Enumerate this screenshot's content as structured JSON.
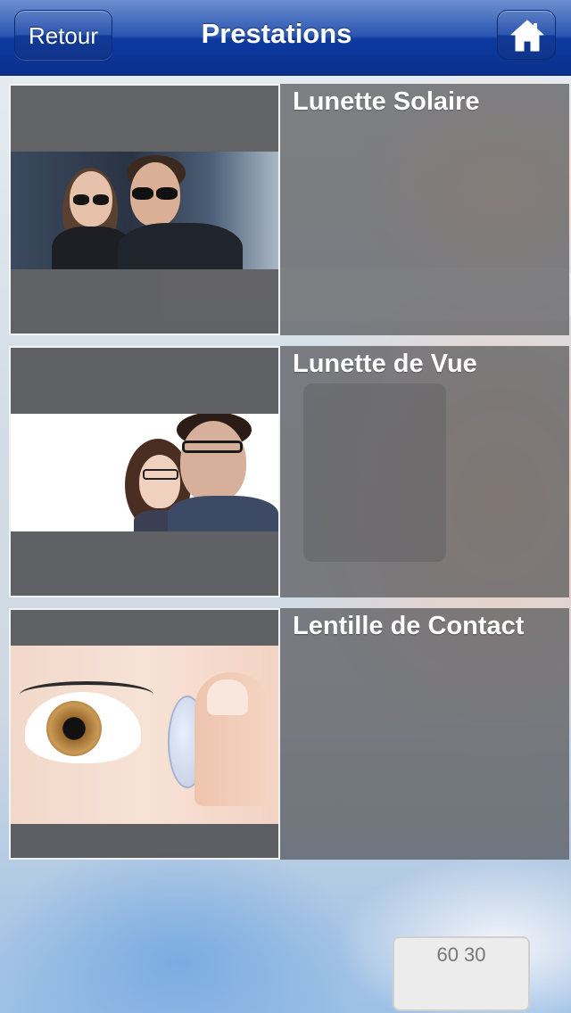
{
  "navbar": {
    "title": "Prestations",
    "back_label": "Retour",
    "home_icon": "home-icon"
  },
  "services": [
    {
      "title": "Lunette Solaire",
      "image": "sunglasses-couple-photo"
    },
    {
      "title": "Lunette de Vue",
      "image": "eyeglasses-couple-photo"
    },
    {
      "title": "Lentille de Contact",
      "image": "contact-lens-photo"
    }
  ],
  "background": {
    "dial_text": "60 30"
  },
  "colors": {
    "navbar": "#0d3aa0",
    "panel_overlay": "#555558",
    "title_text": "#ffffff"
  }
}
